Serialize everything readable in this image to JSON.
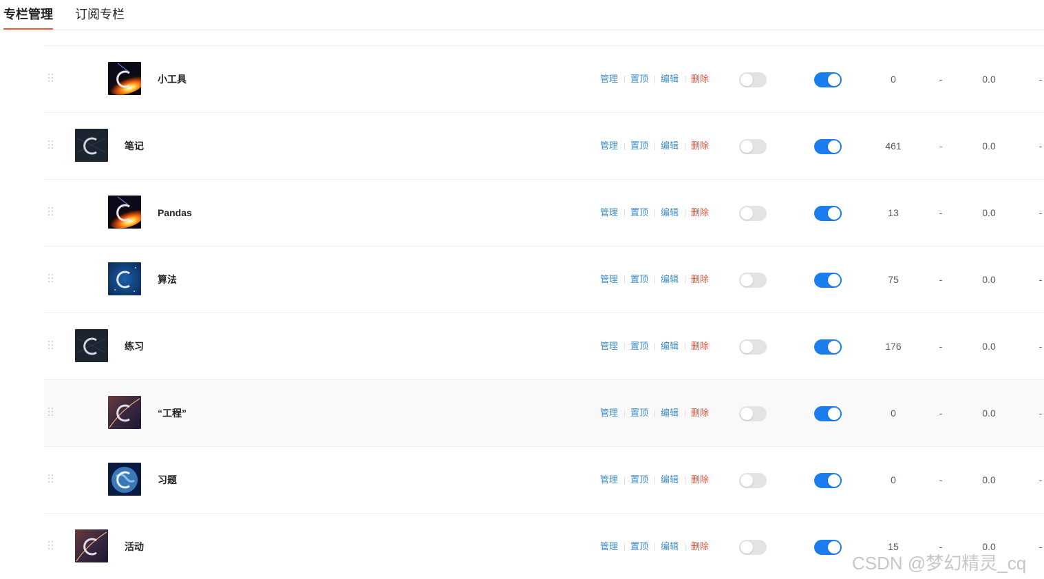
{
  "tabs": [
    {
      "label": "专栏管理",
      "active": true
    },
    {
      "label": "订阅专栏",
      "active": false
    }
  ],
  "actions": {
    "manage": "管理",
    "pin": "置顶",
    "edit": "编辑",
    "delete": "删除"
  },
  "colors": {
    "accent": "#fc5531",
    "link": "#3b8ec8",
    "danger": "#e0533b",
    "toggle_on": "#1a7ef0",
    "toggle_off": "#e3e3e6"
  },
  "rows": [
    {
      "title": "小工具",
      "level": 1,
      "cover": "fire-c-icon",
      "toggle_a": false,
      "toggle_b": true,
      "count": "0",
      "dash1": "-",
      "score": "0.0",
      "dash2": "-"
    },
    {
      "title": "笔记",
      "level": 0,
      "cover": "dark-c-icon",
      "toggle_a": false,
      "toggle_b": true,
      "count": "461",
      "dash1": "-",
      "score": "0.0",
      "dash2": "-"
    },
    {
      "title": "Pandas",
      "level": 1,
      "cover": "fire-c-icon",
      "toggle_a": false,
      "toggle_b": true,
      "count": "13",
      "dash1": "-",
      "score": "0.0",
      "dash2": "-"
    },
    {
      "title": "算法",
      "level": 1,
      "cover": "blue-c-icon",
      "toggle_a": false,
      "toggle_b": true,
      "count": "75",
      "dash1": "-",
      "score": "0.0",
      "dash2": "-"
    },
    {
      "title": "练习",
      "level": 0,
      "cover": "dark-c-icon",
      "toggle_a": false,
      "toggle_b": true,
      "count": "176",
      "dash1": "-",
      "score": "0.0",
      "dash2": "-"
    },
    {
      "title": "“工程”",
      "level": 1,
      "cover": "purple-c-icon",
      "toggle_a": false,
      "toggle_b": true,
      "count": "0",
      "dash1": "-",
      "score": "0.0",
      "dash2": "-"
    },
    {
      "title": "习题",
      "level": 1,
      "cover": "earth-c-icon",
      "toggle_a": false,
      "toggle_b": true,
      "count": "0",
      "dash1": "-",
      "score": "0.0",
      "dash2": "-"
    },
    {
      "title": "活动",
      "level": 0,
      "cover": "purple-c-icon",
      "toggle_a": false,
      "toggle_b": true,
      "count": "15",
      "dash1": "-",
      "score": "0.0",
      "dash2": "-"
    }
  ],
  "watermark": "CSDN @梦幻精灵_cq"
}
